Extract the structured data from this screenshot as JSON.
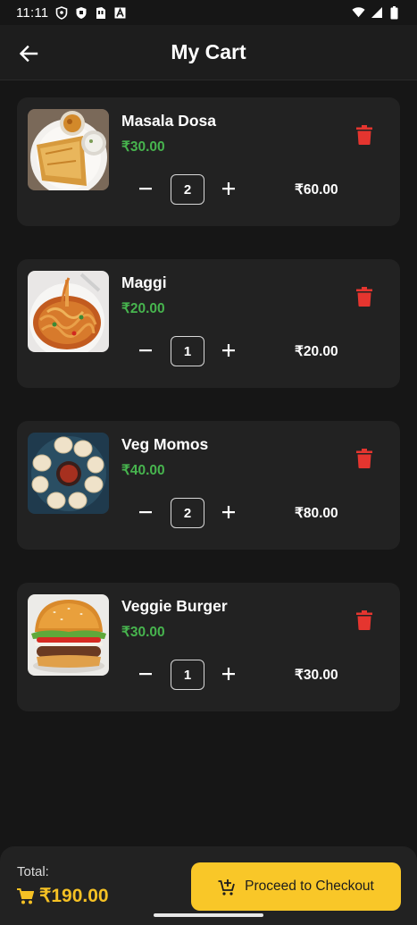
{
  "status_bar": {
    "time": "11:11",
    "icons_left": [
      "shield-icon",
      "shield-filled-icon",
      "sim-card-icon",
      "font-a-icon"
    ],
    "icons_right": [
      "wifi-icon",
      "cellular-signal-icon",
      "battery-icon"
    ]
  },
  "app_bar": {
    "title": "My Cart",
    "back_icon": "arrow-left-icon"
  },
  "cart": {
    "items": [
      {
        "name": "Masala Dosa",
        "price": "₹30.00",
        "quantity": "2",
        "line_total": "₹60.00",
        "image": "masala-dosa-photo"
      },
      {
        "name": "Maggi",
        "price": "₹20.00",
        "quantity": "1",
        "line_total": "₹20.00",
        "image": "maggi-photo"
      },
      {
        "name": "Veg Momos",
        "price": "₹40.00",
        "quantity": "2",
        "line_total": "₹80.00",
        "image": "veg-momos-photo"
      },
      {
        "name": "Veggie Burger",
        "price": "₹30.00",
        "quantity": "1",
        "line_total": "₹30.00",
        "image": "veggie-burger-photo"
      }
    ]
  },
  "summary": {
    "total_label": "Total:",
    "total_amount": "₹190.00",
    "total_icon": "cart-icon"
  },
  "checkout": {
    "label": "Proceed to Checkout",
    "icon": "cart-add-icon"
  },
  "colors": {
    "background": "#161616",
    "card": "#222222",
    "price_green": "#47b44e",
    "delete_red": "#e5352f",
    "accent_yellow": "#f9c728",
    "total_yellow": "#f5c124"
  }
}
